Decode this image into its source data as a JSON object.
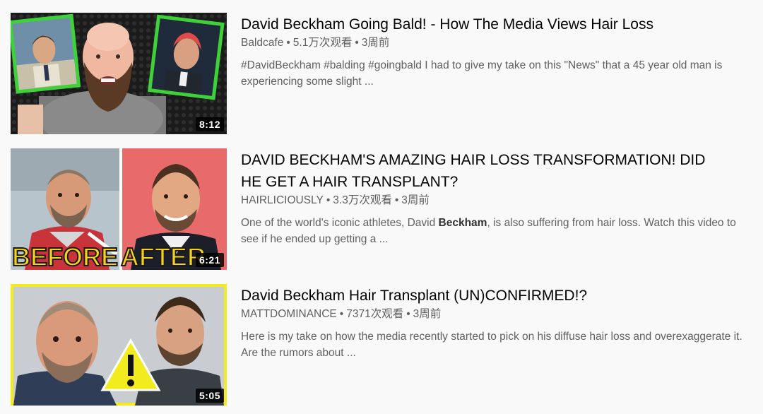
{
  "videos": [
    {
      "title": "David Beckham Going Bald! - How The Media Views Hair Loss",
      "channel": "Baldcafe",
      "views": "5.1万次观看",
      "age": "3周前",
      "duration": "8:12",
      "description_lines": [
        "#DavidBeckham #balding #goingbald I had to give my take on this \"News\" that a 45 year old man is",
        "experiencing some slight ..."
      ]
    },
    {
      "title_lines": [
        "DAVID BECKHAM'S AMAZING HAIR LOSS TRANSFORMATION! DID",
        "HE GET A HAIR TRANSPLANT?"
      ],
      "channel": "HAIRLICIOUSLY",
      "views": "3.3万次观看",
      "age": "3周前",
      "duration": "6:21",
      "thumb_text_left": "BEFORE",
      "thumb_text_right": "AFTER",
      "description": {
        "line1_pre": "One of the world's iconic athletes, David ",
        "line1_bold": "Beckham",
        "line1_post": ", is also suffering from hair loss. Watch this video to",
        "line2": "see if he ended up getting a ..."
      }
    },
    {
      "title": "David Beckham Hair Transplant (UN)CONFIRMED!?",
      "channel": "MATTDOMINANCE",
      "views": "7371次观看",
      "age": "3周前",
      "duration": "5:05",
      "description_lines": [
        "Here is my take on how the media recently started to pick on his diffuse hair loss and overexaggerate it.",
        "Are the rumors about ..."
      ]
    }
  ],
  "separator": "•",
  "colors": {
    "background": "#f9f9f9",
    "title": "#030303",
    "meta": "#606060",
    "thumb1_frame": "#3fd13a",
    "thumb2_text": "#f6d31f",
    "thumb3_frame": "#f2ec1e"
  }
}
